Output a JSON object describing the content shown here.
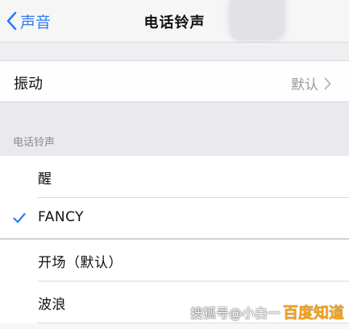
{
  "navbar": {
    "back_label": "声音",
    "title": "电话铃声"
  },
  "vibration": {
    "label": "振动",
    "value": "默认"
  },
  "ringtones": {
    "section_header": "电话铃声",
    "items": [
      {
        "label": "醒",
        "selected": false
      },
      {
        "label": "FANCY",
        "selected": true
      },
      {
        "label": "开场（默认）",
        "selected": false
      },
      {
        "label": "波浪",
        "selected": false
      }
    ]
  },
  "watermark": {
    "prefix": "搜狐号@小白一",
    "brand": "百度知道"
  },
  "colors": {
    "accent": "#2f7cf6",
    "secondary_text": "#9a9aa0",
    "section_bg": "#e9e9ee",
    "watermark_brand": "#f4a11c"
  },
  "icons": {
    "back": "chevron-left-icon",
    "disclosure": "chevron-right-icon",
    "selected": "checkmark-icon"
  }
}
